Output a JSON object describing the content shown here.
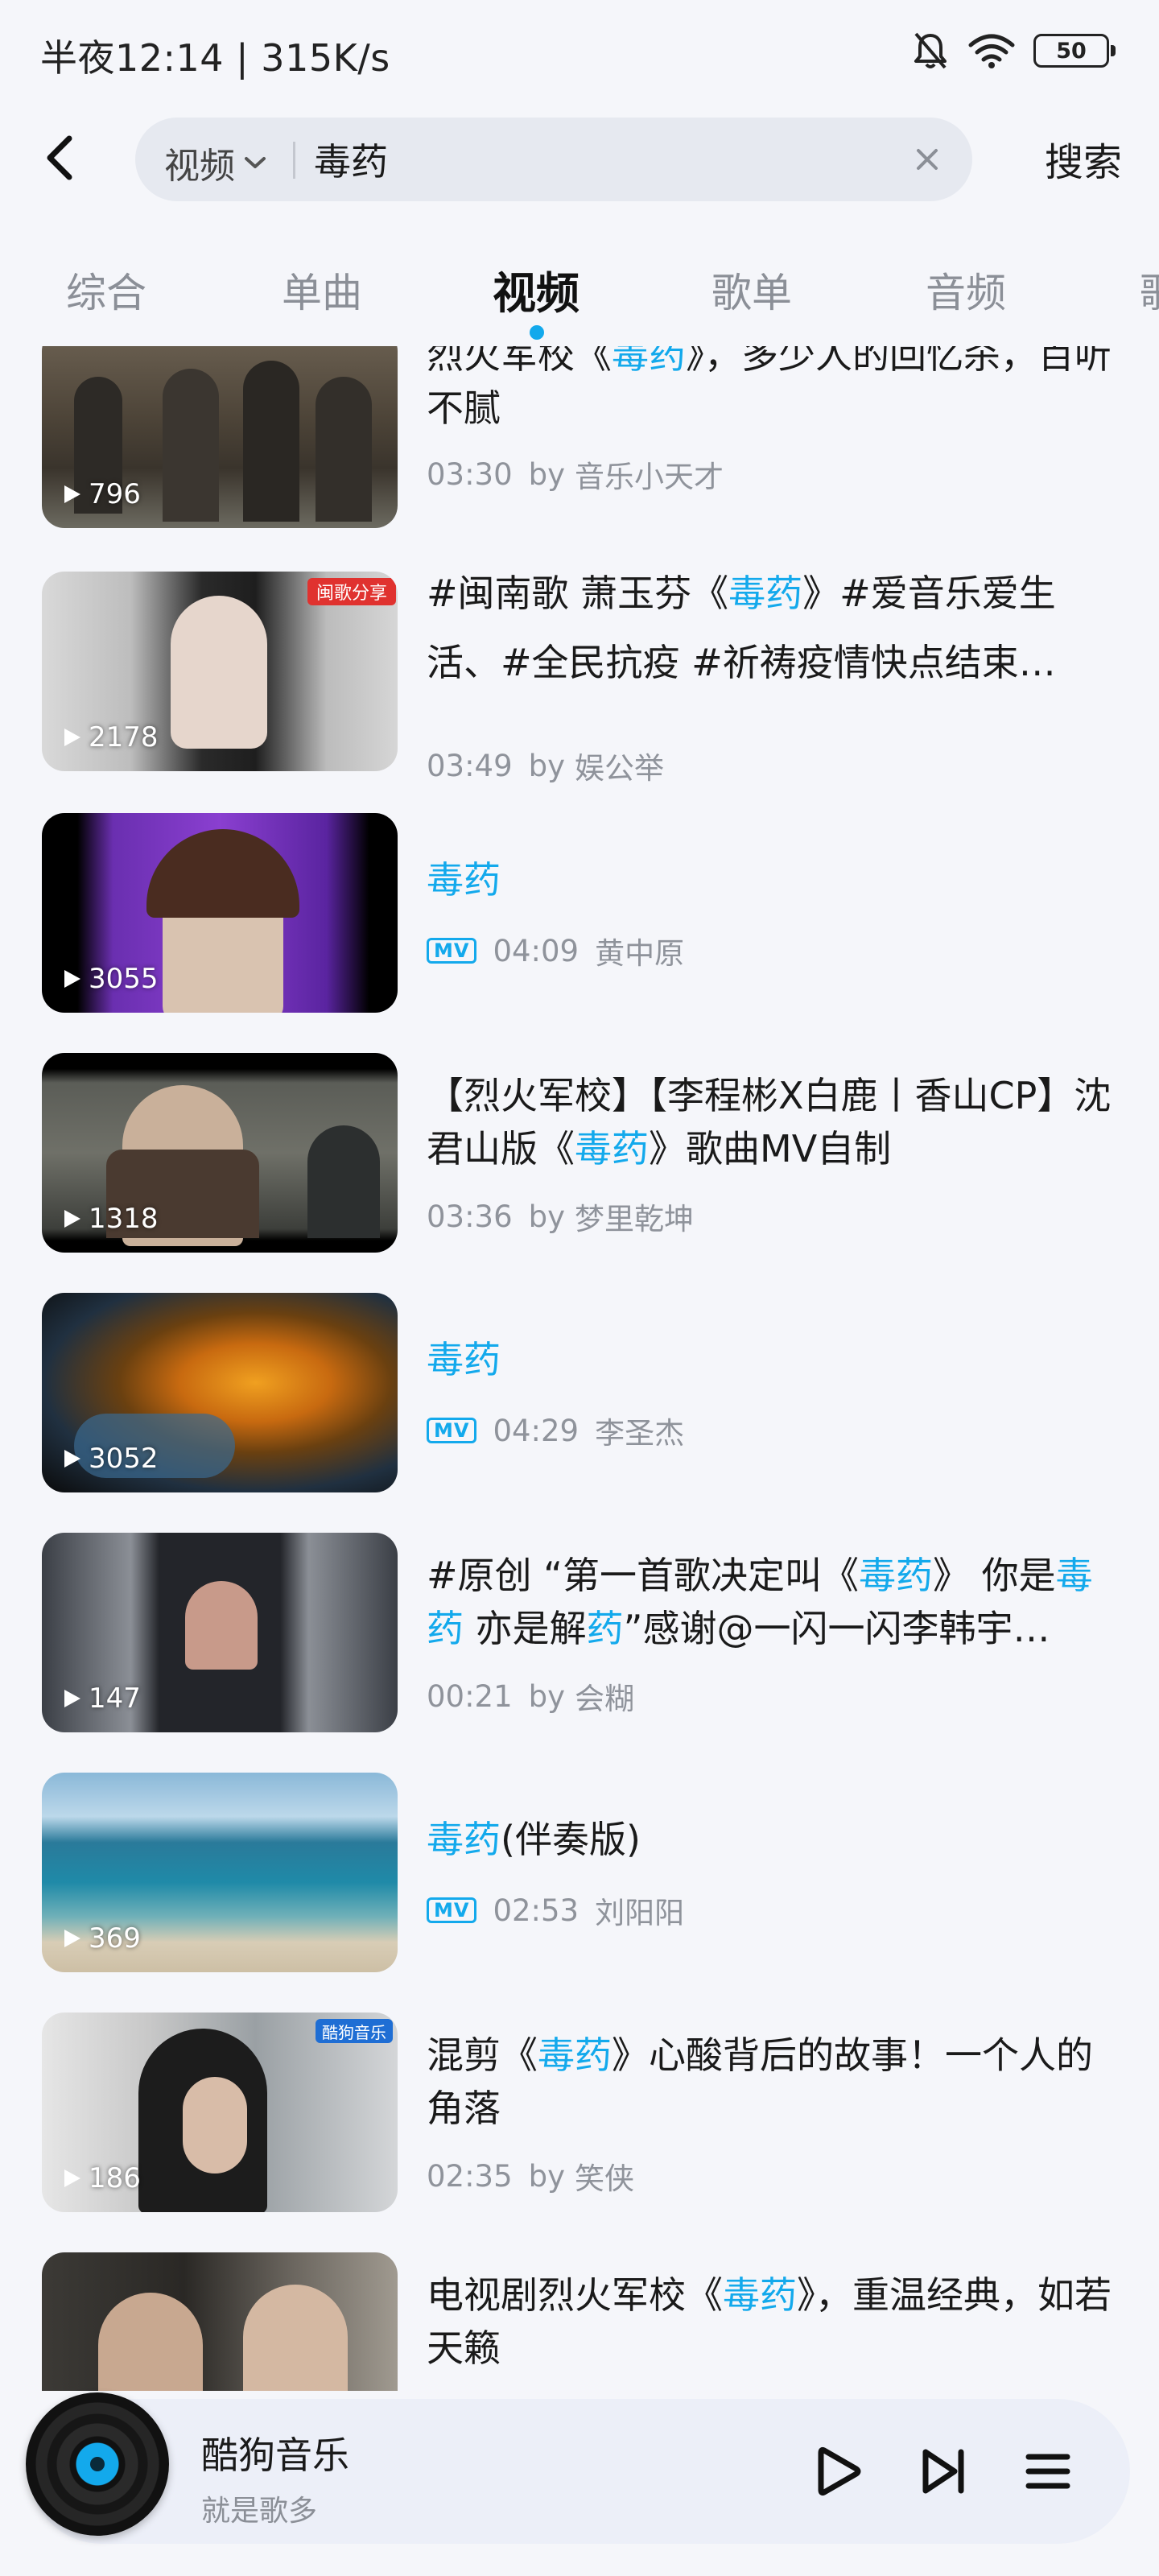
{
  "status_bar": {
    "time": "半夜12:14 | 315K/s",
    "battery": "50"
  },
  "search": {
    "type_label": "视频",
    "query": "毒药",
    "button_label": "搜索"
  },
  "tabs": [
    {
      "label": "综合"
    },
    {
      "label": "单曲"
    },
    {
      "label": "视频",
      "active": true
    },
    {
      "label": "歌单"
    },
    {
      "label": "音频"
    },
    {
      "label": "歌"
    }
  ],
  "videos": [
    {
      "title_parts": [
        {
          "t": "烈火军校《"
        },
        {
          "t": "毒药",
          "hl": true
        },
        {
          "t": "》，多少人的回忆杀，百听不腻"
        }
      ],
      "plays": "796",
      "duration": "03:30",
      "by": "by",
      "author": "音乐小天才",
      "mv": false
    },
    {
      "title_parts": [
        {
          "t": "#闽南歌 萧玉芬《"
        },
        {
          "t": "毒药",
          "hl": true
        },
        {
          "t": "》#爱音乐爱生活、#全民抗疫 #祈祷疫情快点结束…"
        }
      ],
      "plays": "2178",
      "duration": "03:49",
      "by": "by",
      "author": "娱公举",
      "mv": false,
      "thumb_tag": "闽歌分享"
    },
    {
      "title_parts": [
        {
          "t": "毒药",
          "hl": true
        }
      ],
      "plays": "3055",
      "duration": "04:09",
      "author": "黄中原",
      "mv": true,
      "mv_label": "MV"
    },
    {
      "title_parts": [
        {
          "t": "【烈火军校】【李程彬X白鹿丨香山CP】沈君山版《"
        },
        {
          "t": "毒药",
          "hl": true
        },
        {
          "t": "》歌曲MV自制"
        }
      ],
      "plays": "1318",
      "duration": "03:36",
      "by": "by",
      "author": "梦里乾坤",
      "mv": false
    },
    {
      "title_parts": [
        {
          "t": "毒药",
          "hl": true
        }
      ],
      "plays": "3052",
      "duration": "04:29",
      "author": "李圣杰",
      "mv": true,
      "mv_label": "MV"
    },
    {
      "title_parts": [
        {
          "t": "#原创 “第一首歌决定叫《"
        },
        {
          "t": "毒药",
          "hl": true
        },
        {
          "t": "》 你是"
        },
        {
          "t": "毒药",
          "hl": true
        },
        {
          "t": " 亦是解"
        },
        {
          "t": "药",
          "hl": true
        },
        {
          "t": "”感谢@一闪一闪李韩宇…"
        }
      ],
      "plays": "147",
      "duration": "00:21",
      "by": "by",
      "author": "会糊",
      "mv": false
    },
    {
      "title_parts": [
        {
          "t": "毒药",
          "hl": true
        },
        {
          "t": "(伴奏版)"
        }
      ],
      "plays": "369",
      "duration": "02:53",
      "author": "刘阳阳",
      "mv": true,
      "mv_label": "MV"
    },
    {
      "title_parts": [
        {
          "t": "混剪《"
        },
        {
          "t": "毒药",
          "hl": true
        },
        {
          "t": "》心酸背后的故事！一个人的角落"
        }
      ],
      "plays": "186",
      "duration": "02:35",
      "by": "by",
      "author": "笑侠",
      "mv": false,
      "thumb_tag": "酷狗音乐"
    },
    {
      "title_parts": [
        {
          "t": "电视剧烈火军校《"
        },
        {
          "t": "毒药",
          "hl": true
        },
        {
          "t": "》，重温经典，如若天籁"
        }
      ],
      "plays": "",
      "duration": "",
      "author": "",
      "mv": false
    }
  ],
  "player": {
    "title": "酷狗音乐",
    "subtitle": "就是歌多"
  },
  "colors": {
    "accent": "#13a9ec",
    "background": "#f5f6fa"
  }
}
